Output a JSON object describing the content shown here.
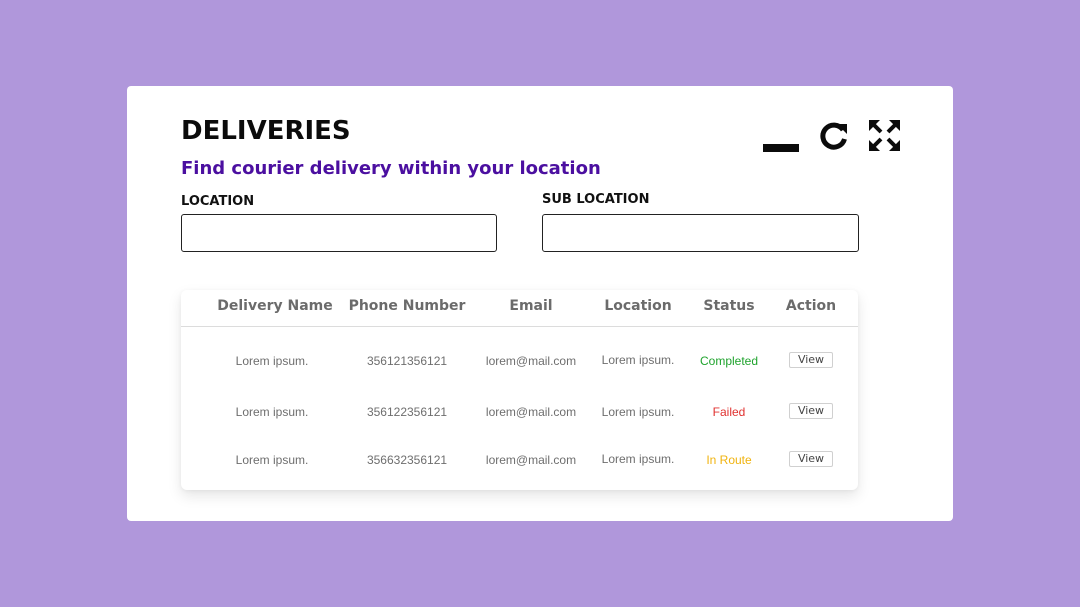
{
  "header": {
    "title": "DELIVERIES",
    "subtitle": "Find courier delivery within your location"
  },
  "window_controls": [
    "minimize-icon",
    "refresh-icon",
    "expand-icon"
  ],
  "filters": {
    "location_label": "LOCATION",
    "location_value": "",
    "sub_location_label": "SUB LOCATION",
    "sub_location_value": ""
  },
  "table": {
    "columns": [
      "Delivery Name",
      "Phone Number",
      "Email",
      "Location",
      "Status",
      "Action"
    ],
    "rows": [
      {
        "name": "Lorem ipsum.",
        "phone": "356121356121",
        "email": "lorem@mail.com",
        "location": "Lorem ipsum.",
        "status": "Completed",
        "action": "View"
      },
      {
        "name": "Lorem ipsum.",
        "phone": "356122356121",
        "email": "lorem@mail.com",
        "location": "Lorem ipsum.",
        "status": "Failed",
        "action": "View"
      },
      {
        "name": "Lorem ipsum.",
        "phone": "356632356121",
        "email": "lorem@mail.com",
        "location": "Lorem ipsum.",
        "status": "In Route",
        "action": "View"
      }
    ]
  },
  "colors": {
    "background": "#b097db",
    "subtitle": "#4b0fa0",
    "status_completed": "#1fa32d",
    "status_failed": "#e0312f",
    "status_in_route": "#f0b30e"
  }
}
